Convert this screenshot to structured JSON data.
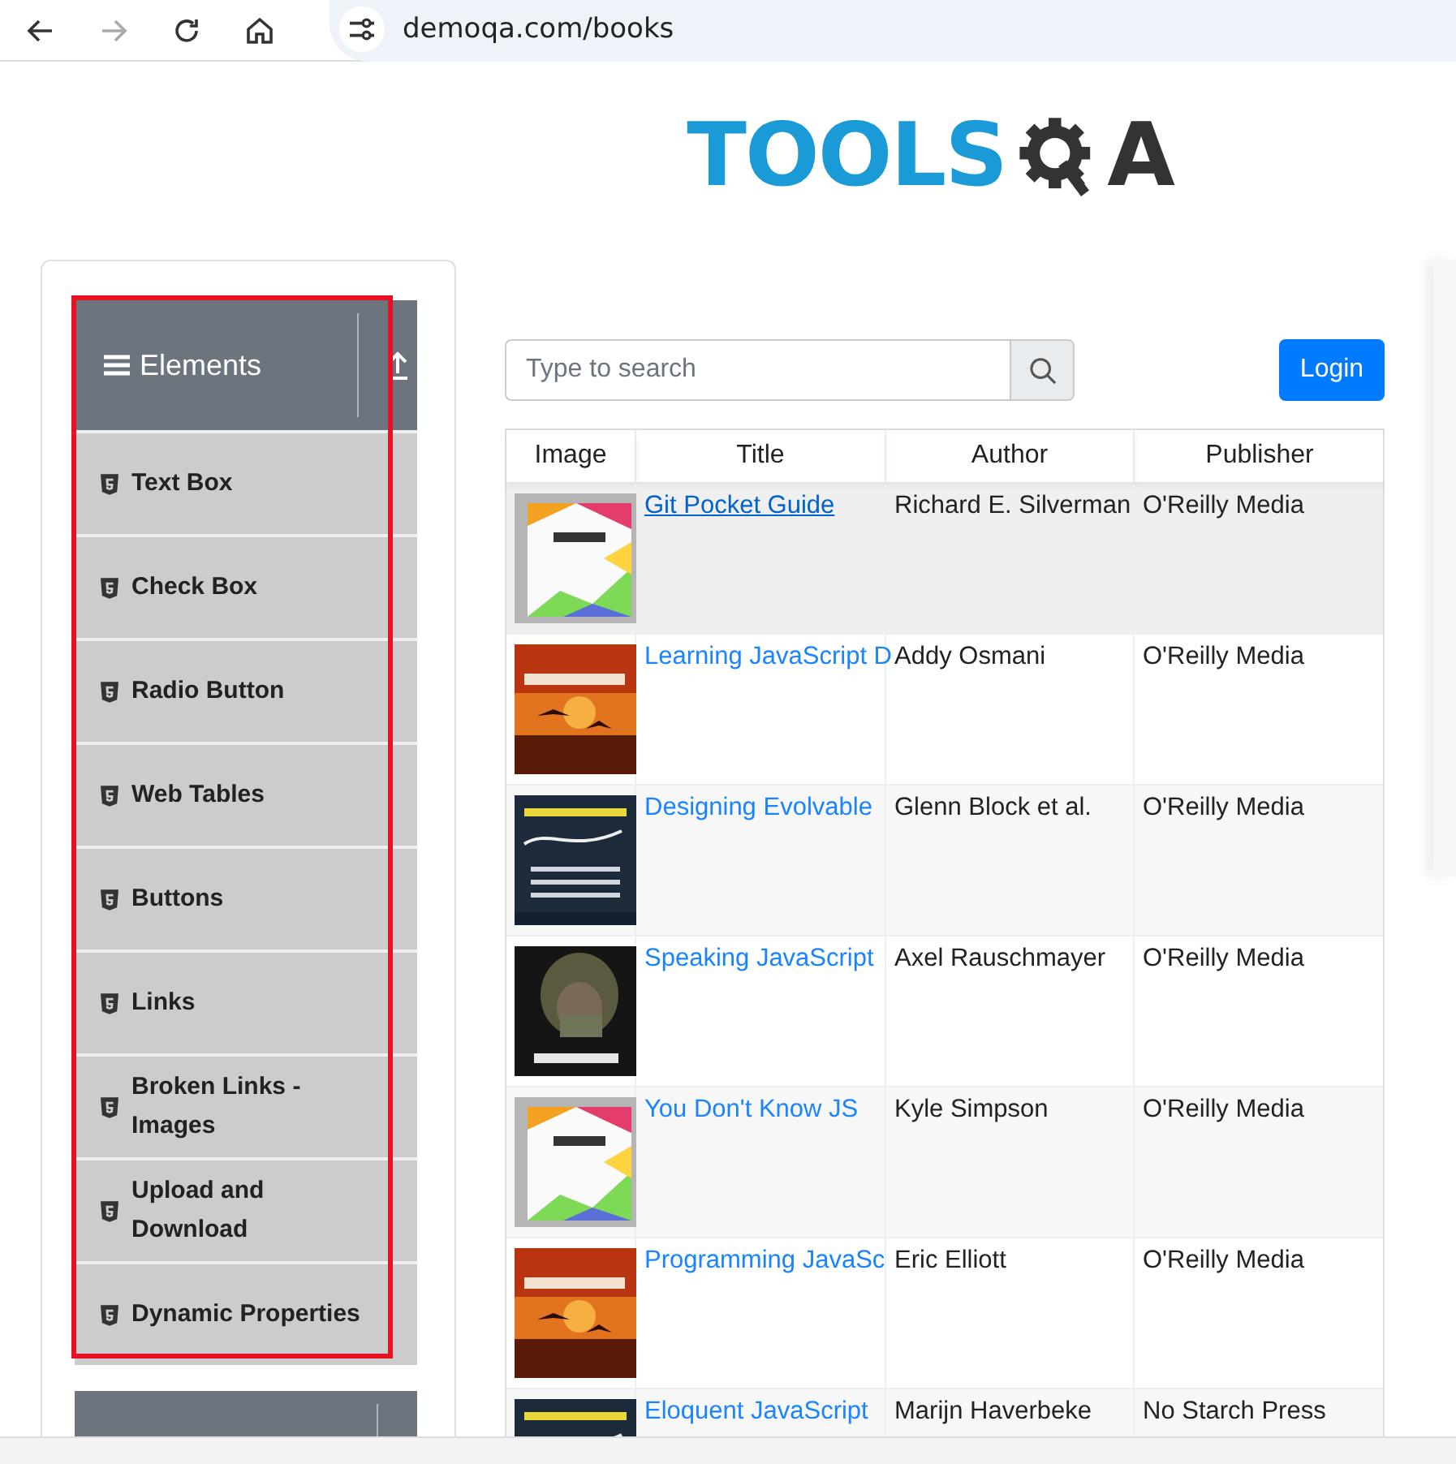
{
  "browser": {
    "address": "demoqa.com/books",
    "back_disabled": false,
    "forward_disabled": true
  },
  "logo": {
    "lead": "TOOLS",
    "tail": "A"
  },
  "sidebar": {
    "groups": [
      {
        "title": "Elements",
        "expanded": true,
        "items": [
          "Text Box",
          "Check Box",
          "Radio Button",
          "Web Tables",
          "Buttons",
          "Links",
          "Broken Links - Images",
          "Upload and Download",
          "Dynamic Properties"
        ]
      },
      {
        "expanded": false
      }
    ]
  },
  "search": {
    "placeholder": "Type to search"
  },
  "login_button": "Login",
  "table": {
    "columns": [
      "Image",
      "Title",
      "Author",
      "Publisher"
    ],
    "rows": [
      {
        "title": "Git Pocket Guide",
        "author": "Richard E. Silverman",
        "publisher": "O'Reilly Media",
        "hovered": true
      },
      {
        "title": "Learning JavaScript D",
        "author": "Addy Osmani",
        "publisher": "O'Reilly Media",
        "hovered": false
      },
      {
        "title": "Designing Evolvable",
        "author": "Glenn Block et al.",
        "publisher": "O'Reilly Media",
        "hovered": false
      },
      {
        "title": "Speaking JavaScript",
        "author": "Axel Rauschmayer",
        "publisher": "O'Reilly Media",
        "hovered": false
      },
      {
        "title": "You Don't Know JS",
        "author": "Kyle Simpson",
        "publisher": "O'Reilly Media",
        "hovered": false
      },
      {
        "title": "Programming JavaSc",
        "author": "Eric Elliott",
        "publisher": "O'Reilly Media",
        "hovered": false
      },
      {
        "title": "Eloquent JavaScript",
        "author": "Marijn Haverbeke",
        "publisher": "No Starch Press",
        "hovered": false
      }
    ]
  },
  "highlight": {
    "shown": true
  }
}
